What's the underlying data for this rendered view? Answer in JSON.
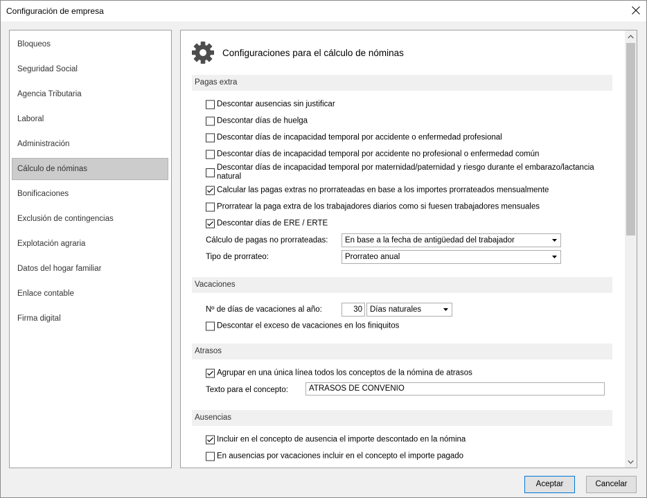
{
  "window": {
    "title": "Configuración de empresa"
  },
  "sidebar": {
    "items": [
      {
        "label": "Bloqueos",
        "selected": false
      },
      {
        "label": "Seguridad Social",
        "selected": false
      },
      {
        "label": "Agencia Tributaria",
        "selected": false
      },
      {
        "label": "Laboral",
        "selected": false
      },
      {
        "label": "Administración",
        "selected": false
      },
      {
        "label": "Cálculo de nóminas",
        "selected": true
      },
      {
        "label": "Bonificaciones",
        "selected": false
      },
      {
        "label": "Exclusión de contingencias",
        "selected": false
      },
      {
        "label": "Explotación agraria",
        "selected": false
      },
      {
        "label": "Datos del hogar familiar",
        "selected": false
      },
      {
        "label": "Enlace contable",
        "selected": false
      },
      {
        "label": "Firma digital",
        "selected": false
      }
    ]
  },
  "main": {
    "title": "Configuraciones para el cálculo de nóminas",
    "pagas_extra": {
      "title": "Pagas extra",
      "options": [
        {
          "label": "Descontar ausencias sin justificar",
          "checked": false
        },
        {
          "label": "Descontar días de huelga",
          "checked": false
        },
        {
          "label": "Descontar días de incapacidad temporal por accidente o enfermedad profesional",
          "checked": false
        },
        {
          "label": "Descontar días de incapacidad temporal por accidente no profesional o enfermedad común",
          "checked": false
        },
        {
          "label": "Descontar días de incapacidad temporal por maternidad/paternidad y riesgo durante el embarazo/lactancia natural",
          "checked": false
        },
        {
          "label": "Calcular las pagas extras no prorrateadas en base a los importes prorrateados mensualmente",
          "checked": true
        },
        {
          "label": "Prorratear la paga extra de los trabajadores diarios como si fuesen trabajadores mensuales",
          "checked": false
        },
        {
          "label": "Descontar días de ERE / ERTE",
          "checked": true
        }
      ],
      "calculo_pagas": {
        "label": "Cálculo de pagas no prorrateadas:",
        "value": "En base a la fecha de antigüedad del trabajador"
      },
      "tipo_prorrateo": {
        "label": "Tipo de prorrateo:",
        "value": "Prorrateo anual"
      }
    },
    "vacaciones": {
      "title": "Vacaciones",
      "dias": {
        "label": "Nº de días de vacaciones al año:",
        "value": "30",
        "unit": "Días naturales"
      },
      "options": [
        {
          "label": "Descontar el exceso de vacaciones en los finiquitos",
          "checked": false
        }
      ]
    },
    "atrasos": {
      "title": "Atrasos",
      "options": [
        {
          "label": "Agrupar en una única línea todos los conceptos de la nómina de atrasos",
          "checked": true
        }
      ],
      "texto_concepto": {
        "label": "Texto para el concepto:",
        "value": "ATRASOS DE CONVENIO"
      }
    },
    "ausencias": {
      "title": "Ausencias",
      "options": [
        {
          "label": "Incluir en el concepto de ausencia el importe descontado en la nómina",
          "checked": true
        },
        {
          "label": "En ausencias por vacaciones incluir en el concepto el importe pagado",
          "checked": false
        }
      ]
    },
    "scrollbar": {
      "position": 0
    }
  },
  "footer": {
    "accept_label": "Aceptar",
    "cancel_label": "Cancelar"
  },
  "icons": {
    "close": "close-icon",
    "header": "gear-icon",
    "checkmark": "checkmark-icon",
    "dropdown": "dropdown-arrow-icon",
    "scroll_up": "chevron-up-icon",
    "scroll_down": "chevron-down-icon"
  },
  "colors": {
    "selected_item_bg": "#cccccc",
    "selected_item_border": "#b4b4b4",
    "section_band_bg": "#f0f0f0",
    "default_button_border": "#0078d7",
    "gear_icon": "#4d4d4d",
    "scroll_thumb": "#c1c1c1"
  }
}
